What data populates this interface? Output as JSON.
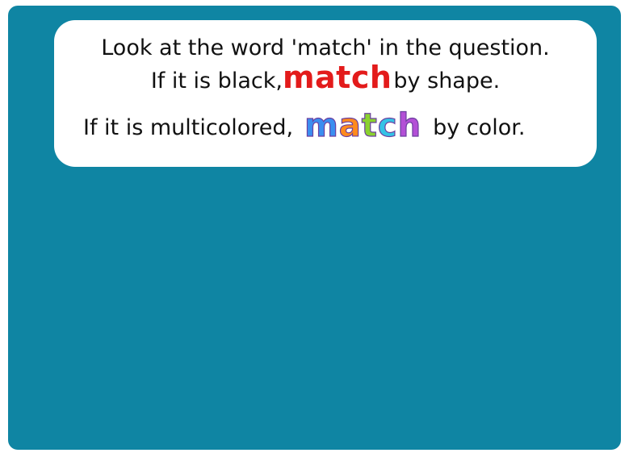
{
  "instructions": {
    "line1": "Look at the word 'match' in the question.",
    "line2_prefix": "If it is black,",
    "line2_word": "match",
    "line2_suffix": "by shape.",
    "line3_prefix": "If it is multicolored,",
    "line3_suffix": "by color."
  },
  "rainbow_word": {
    "letters": [
      "m",
      "a",
      "t",
      "c",
      "h"
    ],
    "colors": [
      "#3b8ef0",
      "#ff8a1d",
      "#8ad12f",
      "#34c3e6",
      "#b34fd6"
    ]
  },
  "colors": {
    "stage_background": "#0f85a3",
    "card_background": "#ffffff",
    "black_match_word": "#e31b1b",
    "text": "#111111"
  }
}
